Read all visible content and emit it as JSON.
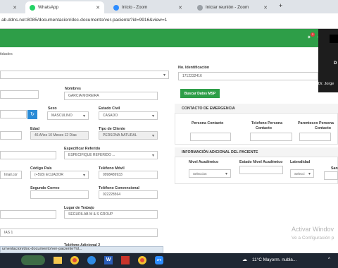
{
  "browser": {
    "tabs": [
      {
        "label": "WhatsApp",
        "close": "✕"
      },
      {
        "label": "Inicio - Zoom",
        "close": "✕"
      },
      {
        "label": "Iniciar reunión - Zoom",
        "close": "✕"
      }
    ],
    "new_tab": "+",
    "url": "ab.ddns.net:8085/documentacion/doc-documento/ver-paciente?id=9916&view=1"
  },
  "header": {
    "badge": "3"
  },
  "page": {
    "breadcrumb": "tidades",
    "identificacion_label": "No. Identificación",
    "identificacion_value": "1712232416",
    "buscar_msp": "Buscar Datos MSP",
    "nombres_label": "Nombres",
    "nombres_value": "GARCIA MOREIRA",
    "sexo_label": "Sexo",
    "sexo_value": "MASCULINO",
    "estado_civil_label": "Estado Civil",
    "estado_civil_value": "CASADO",
    "edad_label": "Edad",
    "edad_value": "46 Años 10 Meses 12 Días",
    "tipo_cliente_label": "Tipo de Cliente",
    "tipo_cliente_value": "PERSONA NATURAL",
    "especificar_label": "Especificar Referido",
    "especificar_value": "ESPECIFIQUE REFERIDO ...",
    "codigo_pais_label": "Código País",
    "codigo_pais_value": "(+593) ECUADOR",
    "telefono_movil_label": "Teléfono Móvil",
    "telefono_movil_value": "0998489933",
    "email_partial": "Imail.cor",
    "segundo_correo_label": "Segundo Correo",
    "telefono_conv_label": "Teléfono Convencional",
    "telefono_conv_value": "022228564",
    "lugar_trabajo_label": "Lugar de Trabajo",
    "lugar_trabajo_value": "SEGURILAB M & S GROUP",
    "direccion_partial": "IAS 1",
    "telefono_adicional_label": "Teléfono Adicional 2"
  },
  "emergencia": {
    "title": "CONTACTO DE EMERGENCIA",
    "col1": "Persona Contacto",
    "col2a": "Telefono Persona",
    "col2b": "Contacto",
    "col3a": "Parentesco Persona",
    "col3b": "Contacto"
  },
  "adicional": {
    "title": "INFORMACIÓN ADICIONAL DEL PACIENTE",
    "nivel_label": "Nivel Académico",
    "nivel_value": "Seleccion",
    "estado_nivel_label": "Estado Nivel Académico",
    "lateralidad_label": "Lateralidad",
    "lateralidad_value": "Selecci",
    "san_label": "San"
  },
  "zoom": {
    "name": "Dr. Jorge"
  },
  "watermark": {
    "title": "Activar Windov",
    "subtitle": "Ve a Configuración p"
  },
  "statusbar": {
    "url": "umentacion/doc-documento/ver-paciente?id..."
  },
  "taskbar": {
    "weather": "11°C  Mayorm. nubla..."
  }
}
